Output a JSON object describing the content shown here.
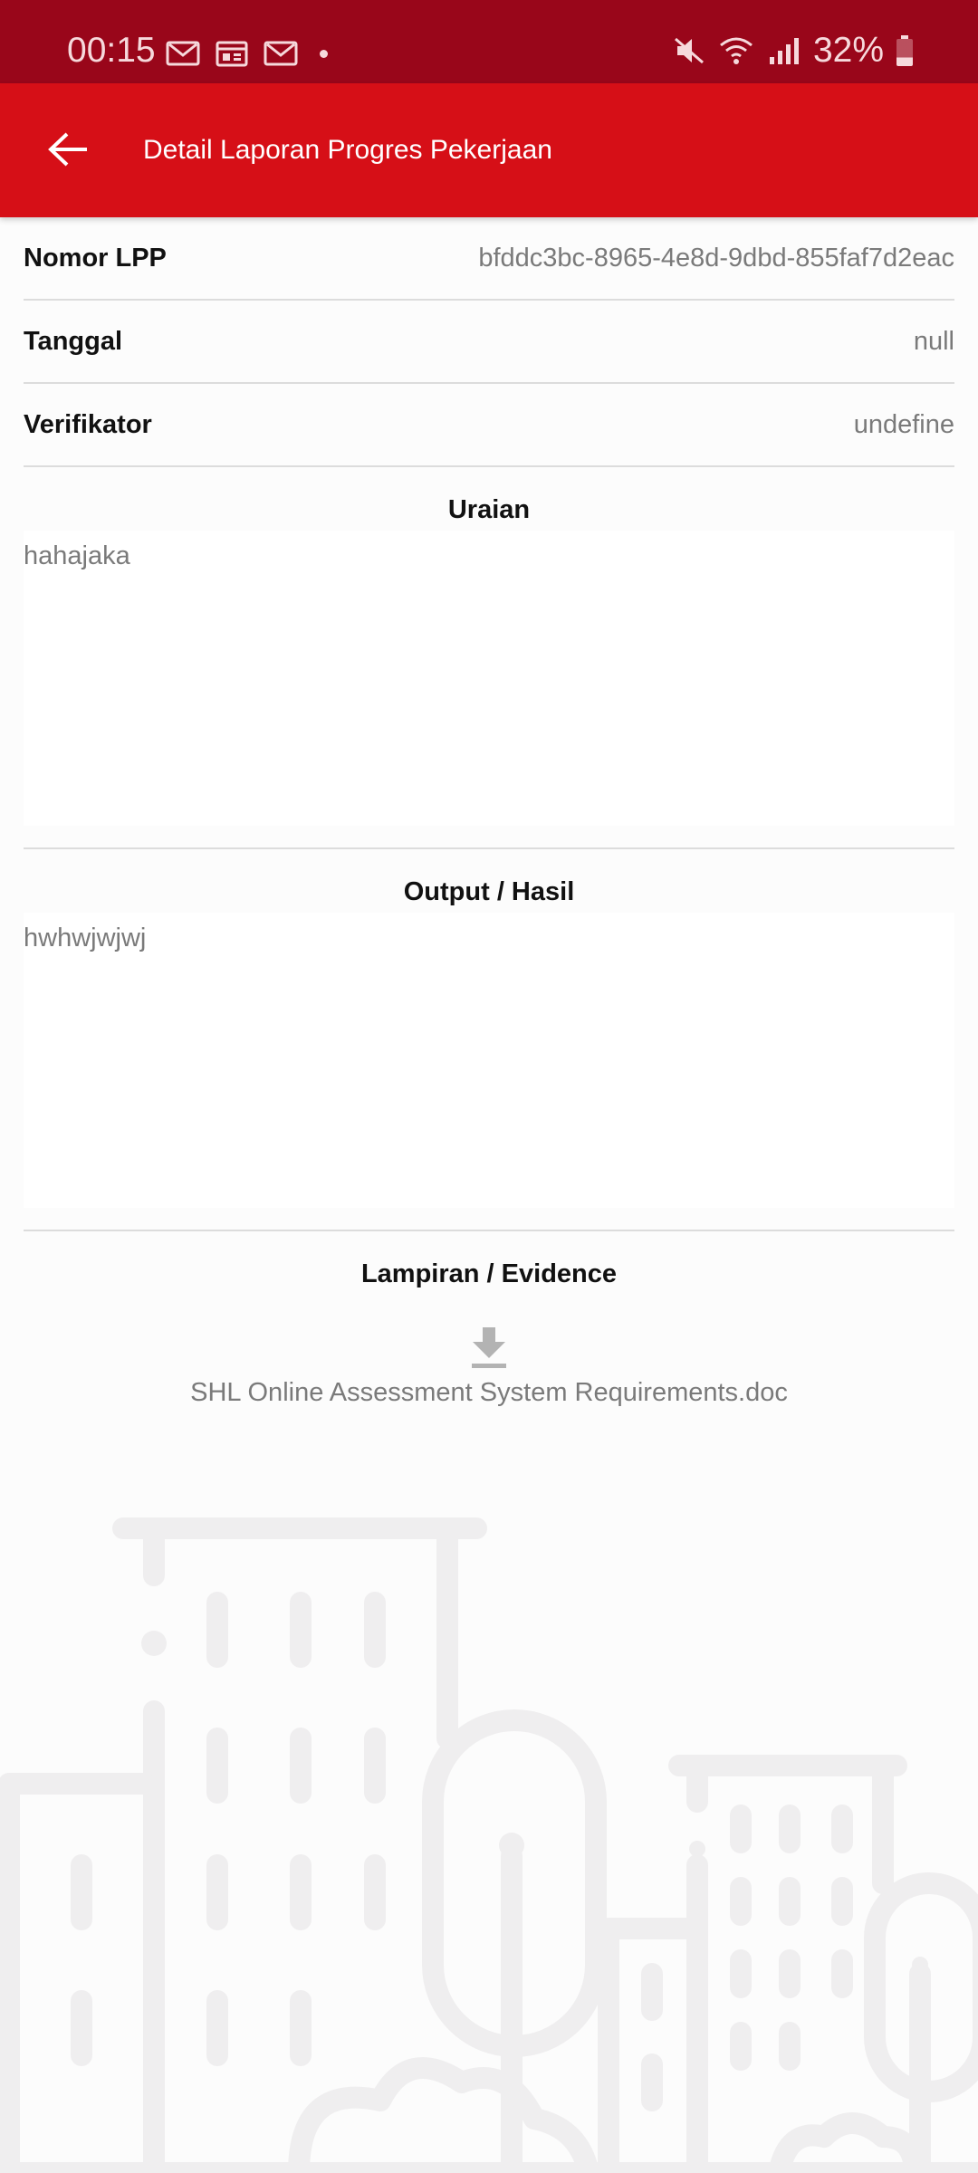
{
  "status_bar": {
    "time": "00:15",
    "battery": "32%",
    "left_icons": [
      "gmail-icon",
      "calendar-icon",
      "gmail-icon"
    ],
    "right_icons": [
      "mute-icon",
      "wifi-icon",
      "signal-icon",
      "battery-icon"
    ]
  },
  "app_bar": {
    "title": "Detail Laporan Progres Pekerjaan",
    "back_icon": "arrow-left-icon",
    "color": "#d60f17"
  },
  "details": {
    "nomor_lpp_label": "Nomor LPP",
    "nomor_lpp_value": "bfddc3bc-8965-4e8d-9dbd-855faf7d2eac",
    "tanggal_label": "Tanggal",
    "tanggal_value": "null",
    "verifikator_label": "Verifikator",
    "verifikator_value": "undefine"
  },
  "uraian": {
    "title": "Uraian",
    "text": "hahajaka"
  },
  "output": {
    "title": "Output / Hasil",
    "text": "hwhwjwjwj"
  },
  "lampiran": {
    "title": "Lampiran / Evidence",
    "icon": "download-icon",
    "file_name": "SHL Online Assessment System Requirements.doc"
  },
  "colors": {
    "status_bar": "#99061a",
    "app_bar": "#d60f17",
    "background": "#fcfcfc"
  }
}
